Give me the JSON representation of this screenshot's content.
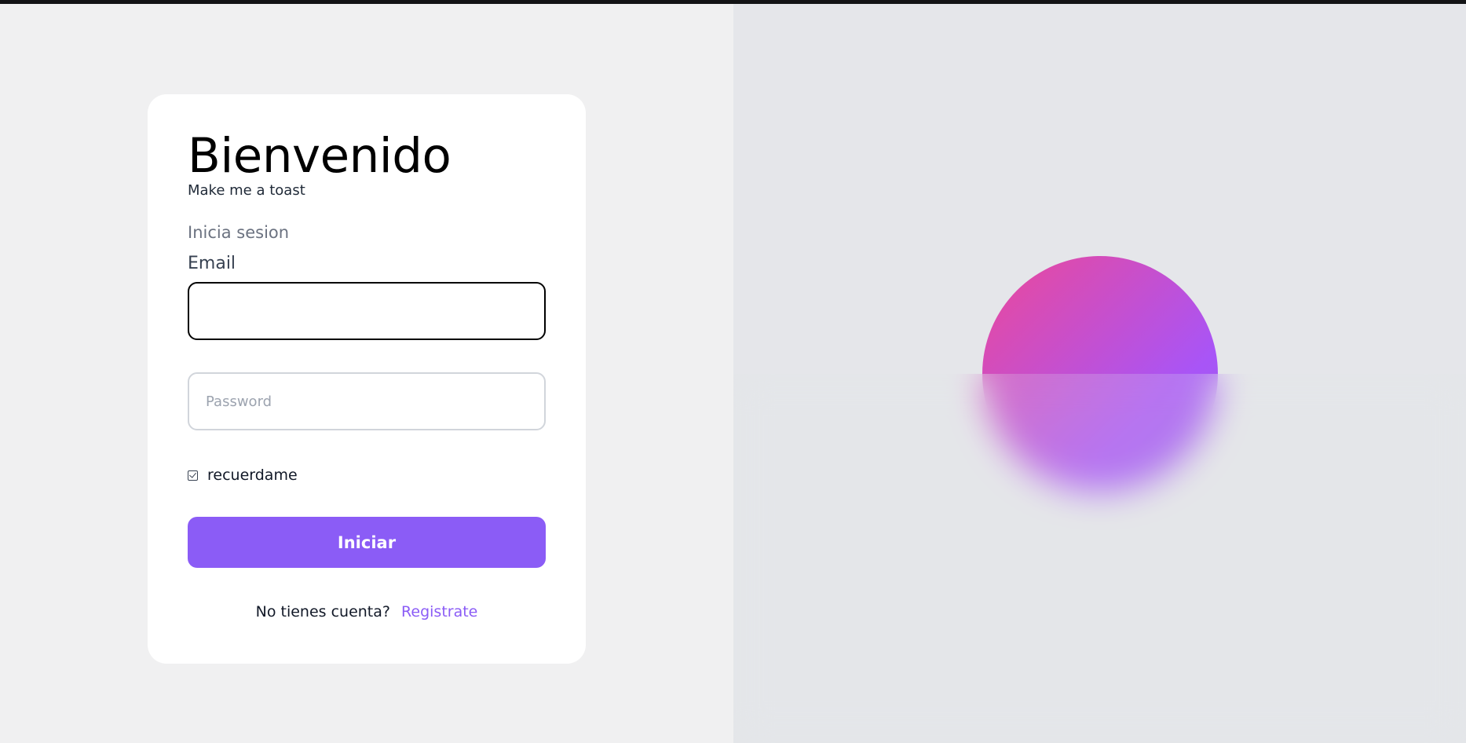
{
  "colors": {
    "accent": "#8b5cf6",
    "orb_start": "#ec4899",
    "orb_end": "#a855f7"
  },
  "login": {
    "title": "Bienvenido",
    "subtitle": "Make me a toast",
    "section_label": "Inicia sesion",
    "email_label": "Email",
    "email_value": "",
    "password_placeholder": "Password",
    "remember_label": "recuerdame",
    "remember_checked": true,
    "submit_label": "Iniciar",
    "signup_prompt": "No tienes cuenta?",
    "signup_link": "Registrate"
  },
  "decor": {
    "icon": "gradient-orb"
  }
}
